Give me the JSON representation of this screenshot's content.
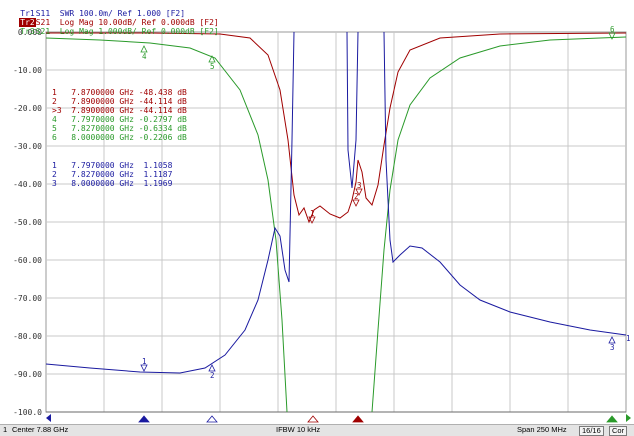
{
  "traces": [
    {
      "label": "Tr1",
      "text": "S11  SWR 100.0m/ Ref 1.000 [F2]",
      "color": "#1a1aa0",
      "active": false
    },
    {
      "label": "Tr2",
      "text": "S21  Log Mag 10.00dB/ Ref 0.000dB [F2]",
      "color": "#a00000",
      "active": true
    },
    {
      "label": "Tr3",
      "text": "S21  Log Mag 1.000dB/ Ref 0.000dB [F2]",
      "color": "#2a9a2a",
      "active": false
    }
  ],
  "y_axis_labels": [
    "0.000",
    "-10.00",
    "-20.00",
    "-30.00",
    "-40.00",
    "-50.00",
    "-60.00",
    "-70.00",
    "-80.00",
    "-90.00",
    "-100.0"
  ],
  "marker_readouts": {
    "red": [
      "1   7.8700000 GHz -48.438 dB",
      "2   7.8900000 GHz -44.114 dB",
      ">3  7.8900000 GHz -44.114 dB"
    ],
    "green": [
      "4   7.7970000 GHz -0.2797 dB",
      "5   7.8270000 GHz -0.6334 dB",
      "6   8.0000000 GHz -0.2206 dB"
    ],
    "blue": [
      "1   7.7970000 GHz  1.1058",
      "2   7.8270000 GHz  1.1187",
      "3   8.0000000 GHz  1.1969"
    ]
  },
  "marker_flags": {
    "green_4": "4",
    "green_5": "5",
    "green_6": "6",
    "blue_1": "1",
    "blue_2": "2",
    "blue_3": "3",
    "red_1": "1",
    "red_2": "2",
    "red_3": "3",
    "right_edge_1": "1"
  },
  "colors": {
    "tr1": "#1a1aa0",
    "tr2": "#a00000",
    "tr3": "#2a9a2a",
    "grid": "#c8c8c8"
  },
  "status": {
    "channel": "1",
    "center": "Center 7.88 GHz",
    "ifbw": "IFBW 10 kHz",
    "span": "Span 250 MHz",
    "sweep": "16/16",
    "cor": "Cor"
  }
}
